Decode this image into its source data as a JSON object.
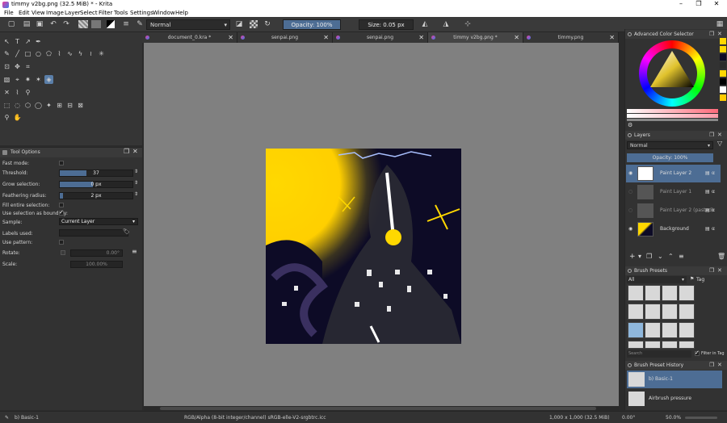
{
  "window": {
    "title": "timmy v2bg.png (32.5 MiB) * - Krita",
    "controls": [
      "–",
      "❐",
      "✕"
    ]
  },
  "menu": [
    "File",
    "Edit",
    "View",
    "Image",
    "Layer",
    "Select",
    "Filter",
    "Tools",
    "Settings",
    "Window",
    "Help"
  ],
  "toolbar": {
    "blend_mode": "Normal",
    "opacity_label": "Opacity: 100%",
    "opacity_fraction": 1.0,
    "size_label": "Size: 0.05 px"
  },
  "tabs": [
    {
      "label": "document_0.kra *",
      "active": false
    },
    {
      "label": "senpai.png",
      "active": false
    },
    {
      "label": "senpai.png",
      "active": false
    },
    {
      "label": "timmy v2bg.png *",
      "active": true
    },
    {
      "label": "timmy.png",
      "active": false
    }
  ],
  "tool_options": {
    "title": "Tool Options",
    "fast_mode": {
      "label": "Fast mode:",
      "checked": false
    },
    "threshold": {
      "label": "Threshold:",
      "value": "37",
      "fraction": 0.37
    },
    "grow_selection": {
      "label": "Grow selection:",
      "value": "0 px",
      "fraction": 0.45
    },
    "feathering_radius": {
      "label": "Feathering radius:",
      "value": "2 px",
      "fraction": 0.03
    },
    "fill_entire_selection": {
      "label": "Fill entire selection:",
      "checked": false
    },
    "use_selection_as_boundary": {
      "label": "Use selection as boundary:",
      "checked": true
    },
    "sample": {
      "label": "Sample:",
      "value": "Current Layer"
    },
    "labels_used": {
      "label": "Labels used:"
    },
    "use_pattern": {
      "label": "Use pattern:",
      "checked": false
    },
    "rotate": {
      "label": "Rotate:",
      "value": "0.00°"
    },
    "scale": {
      "label": "Scale:",
      "value": "100.00%"
    }
  },
  "color_selector": {
    "title": "Advanced Color Selector"
  },
  "layers": {
    "title": "Layers",
    "blend_mode": "Normal",
    "opacity_label": "Opacity: 100%",
    "items": [
      {
        "name": "Paint Layer 2",
        "selected": true,
        "visible": true
      },
      {
        "name": "Paint Layer 1",
        "selected": false,
        "visible": false
      },
      {
        "name": "Paint Layer 2 (pasted)",
        "selected": false,
        "visible": false
      },
      {
        "name": "Background",
        "selected": false,
        "visible": true
      }
    ]
  },
  "brush_presets": {
    "title": "Brush Presets",
    "filter_value": "All",
    "tag_label": "Tag",
    "search_placeholder": "Search",
    "filter_in_tag_label": "Filter in Tag",
    "filter_in_tag_checked": true
  },
  "brush_history": {
    "title": "Brush Preset History",
    "items": [
      {
        "name": "b) Basic-1",
        "selected": true
      },
      {
        "name": "Airbrush pressure",
        "selected": false
      }
    ]
  },
  "status": {
    "brush": "b) Basic-1",
    "color_space": "RGB/Alpha (8-bit integer/channel)  sRGB-elle-V2-srgbtrc.icc",
    "dimensions": "1,000 x 1,000 (32.5 MiB)",
    "rotation": "0.00°",
    "zoom": "50.0%"
  },
  "colors": {
    "accent": "#4d6d94",
    "artwork_dark": "#0d0b26",
    "artwork_yellow": "#ffd800"
  }
}
